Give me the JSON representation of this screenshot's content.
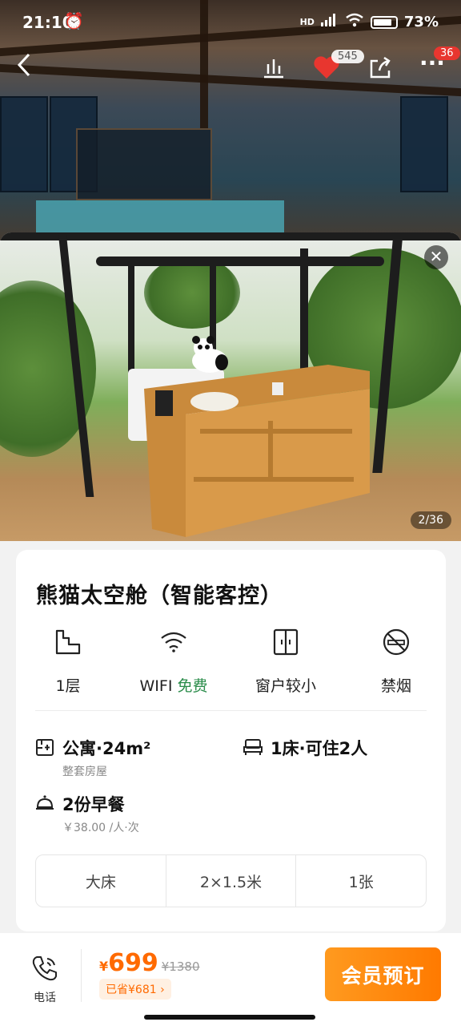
{
  "status": {
    "time": "21:10",
    "battery": "73%",
    "network": "HD"
  },
  "topbar": {
    "like_count": "545",
    "more_badge": "36"
  },
  "gallery": {
    "counter": "2/36"
  },
  "room": {
    "title": "熊猫太空舱（智能客控）",
    "amenities": [
      {
        "icon": "floor-icon",
        "label": "1层",
        "extra": ""
      },
      {
        "icon": "wifi-icon",
        "label": "WIFI",
        "extra": "免费"
      },
      {
        "icon": "window-icon",
        "label": "窗户较小",
        "extra": ""
      },
      {
        "icon": "no-smoking-icon",
        "label": "禁烟",
        "extra": ""
      }
    ],
    "details": {
      "type_main": "公寓·24m²",
      "type_sub": "整套房屋",
      "bed_main": "1床·可住2人",
      "breakfast_main": "2份早餐",
      "breakfast_sub": "￥38.00 /人·次"
    },
    "bed_table": [
      "大床",
      "2×1.5米",
      "1张"
    ]
  },
  "bottom": {
    "phone_label": "电话",
    "currency": "¥",
    "price": "699",
    "old_price": "¥1380",
    "saved": "已省¥681",
    "book_label": "会员预订"
  },
  "colors": {
    "accent": "#ff7a00",
    "free_green": "#2a8c4a",
    "like_red": "#e8362f"
  }
}
